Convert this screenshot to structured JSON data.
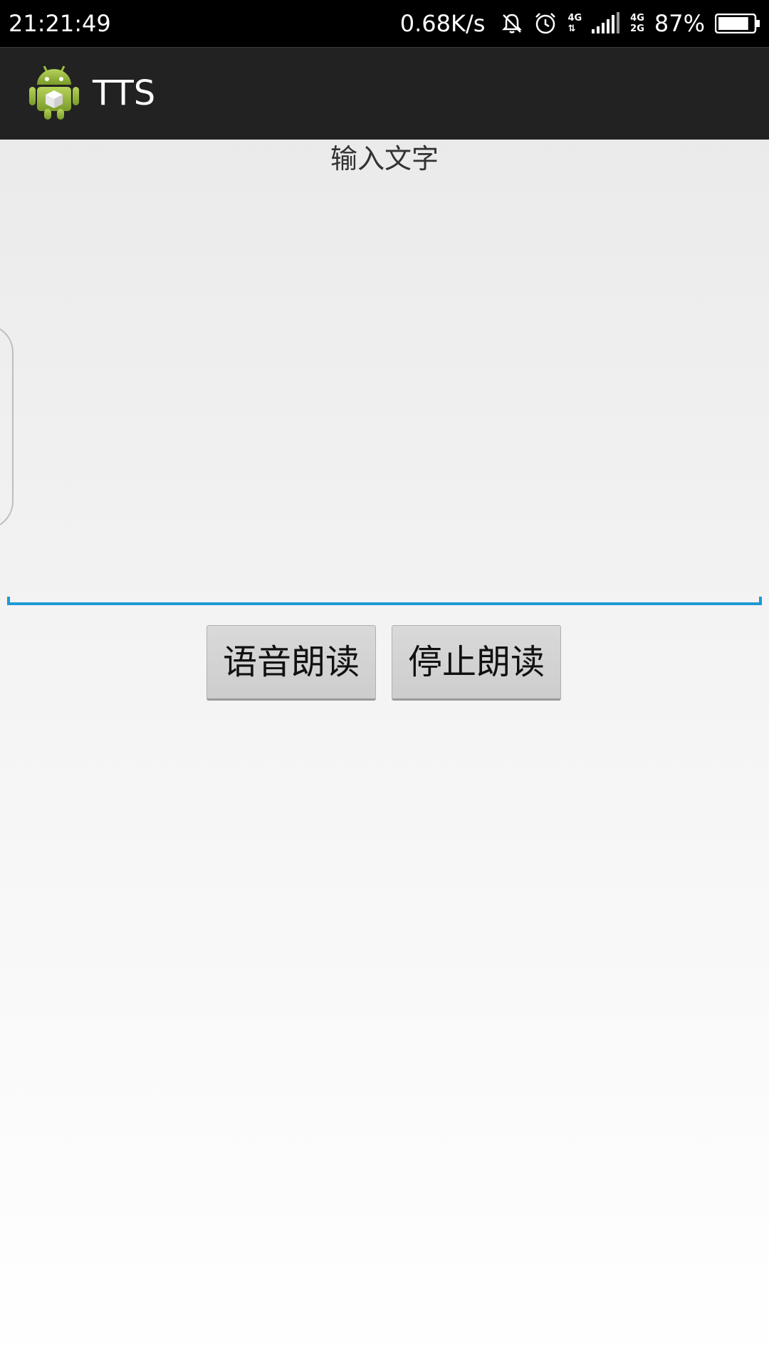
{
  "status_bar": {
    "time": "21:21:49",
    "net_speed": "0.68K/s",
    "net_type_top": "4G",
    "net_type_bottom": "2G",
    "net_type_left": "4G",
    "battery": "87%",
    "battery_level": 0.87,
    "icons": [
      "bell-muted-icon",
      "alarm-icon",
      "data-arrows-icon",
      "signal-icon",
      "battery-icon"
    ]
  },
  "action_bar": {
    "title": "TTS",
    "icon": "android-robot-icon"
  },
  "main": {
    "input_hint": "输入文字",
    "input_value": "",
    "speak_button": "语音朗读",
    "stop_button": "停止朗读"
  },
  "colors": {
    "status_bar_bg": "#000000",
    "action_bar_bg": "#222222",
    "accent_underline": "#1e9ad3",
    "button_bg": "#d3d3d3",
    "android_green": "#9fbf3b"
  }
}
